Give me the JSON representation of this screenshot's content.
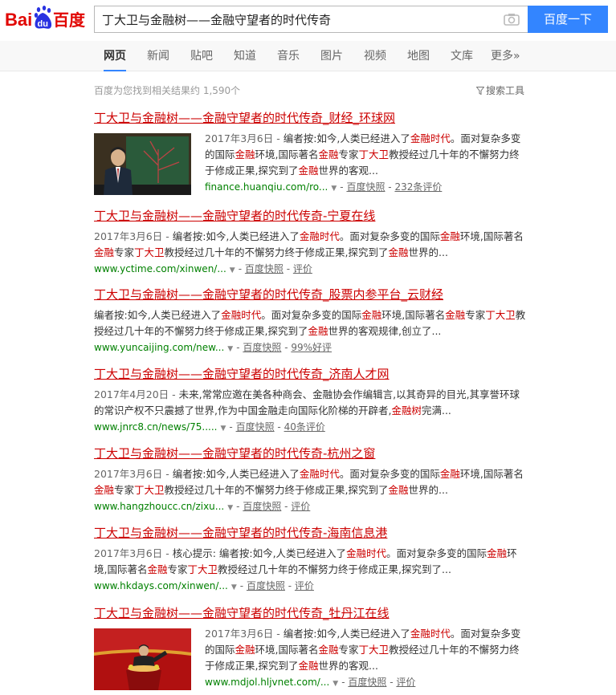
{
  "header": {
    "logo_text_red": "Bai",
    "logo_text_blue": "du",
    "logo_text_cn": "百度",
    "query": "丁大卫与金融树——金融守望者的时代传奇",
    "search_button": "百度一下",
    "brand_red": "#e10602",
    "brand_blue": "#2932e1"
  },
  "tabs": [
    {
      "label": "网页",
      "active": true
    },
    {
      "label": "新闻"
    },
    {
      "label": "贴吧"
    },
    {
      "label": "知道"
    },
    {
      "label": "音乐"
    },
    {
      "label": "图片"
    },
    {
      "label": "视频"
    },
    {
      "label": "地图"
    },
    {
      "label": "文库"
    },
    {
      "label": "更多»"
    }
  ],
  "meta": {
    "result_count": "百度为您找到相关结果约 1,590个",
    "search_tools": "搜索工具"
  },
  "results": [
    {
      "title": "丁大卫与金融树——金融守望者的时代传奇_财经_环球网",
      "abstract_html": "<span class=\"date\">2017年3月6日 - </span>编者按:如今,人类已经进入了<em>金融时代</em>。面对复杂多变的国际<em>金融</em>环境,国际著名<em>金融</em>专家<em>丁大卫</em>教授经过几十年的不懈努力终于修成正果,探究到了<em>金融</em>世界的客观...",
      "url": "finance.huanqiu.com/ro...",
      "snapshot": "百度快照",
      "extra": "232条评价",
      "thumb": "lecture"
    },
    {
      "title": "丁大卫与金融树——金融守望者的时代传奇-宁夏在线",
      "abstract_html": "<span class=\"date\">2017年3月6日 - </span>编者按:如今,人类已经进入了<em>金融时代</em>。面对复杂多变的国际<em>金融</em>环境,国际著名<em>金融</em>专家<em>丁大卫</em>教授经过几十年的不懈努力终于修成正果,探究到了<em>金融</em>世界的...",
      "url": "www.yctime.com/xinwen/...",
      "snapshot": "百度快照",
      "extra": "评价"
    },
    {
      "title": "丁大卫与金融树——金融守望者的时代传奇_股票内参平台_云财经",
      "abstract_html": "编者按:如今,人类已经进入了<em>金融时代</em>。面对复杂多变的国际<em>金融</em>环境,国际著名<em>金融</em>专家<em>丁大卫</em>教授经过几十年的不懈努力终于修成正果,探究到了<em>金融</em>世界的客观规律,创立了...",
      "url": "www.yuncaijing.com/new...",
      "snapshot": "百度快照",
      "extra": "99%好评"
    },
    {
      "title": "丁大卫与金融树——金融守望者的时代传奇_济南人才网",
      "abstract_html": "<span class=\"date\">2017年4月20日 - </span>未来,常常应邀在美各种商会、金融协会作编辑言,以其奇异的目光,其享誉环球的常识产权不只震撼了世界,作为中国金融走向国际化阶梯的开辟者,<em>金融树</em>完满...",
      "url": "www.jnrc8.cn/news/75.....",
      "snapshot": "百度快照",
      "extra": "40条评价"
    },
    {
      "title": "丁大卫与金融树——金融守望者的时代传奇-杭州之窗",
      "abstract_html": "<span class=\"date\">2017年3月6日 - </span>编者按:如今,人类已经进入了<em>金融时代</em>。面对复杂多变的国际<em>金融</em>环境,国际著名<em>金融</em>专家<em>丁大卫</em>教授经过几十年的不懈努力终于修成正果,探究到了<em>金融</em>世界的...",
      "url": "www.hangzhoucc.cn/zixu...",
      "snapshot": "百度快照",
      "extra": "评价"
    },
    {
      "title": "丁大卫与金融树——金融守望者的时代传奇-海南信息港",
      "abstract_html": "<span class=\"date\">2017年3月6日 - </span>核心提示: 编者按:如今,人类已经进入了<em>金融时代</em>。面对复杂多变的国际<em>金融</em>环境,国际著名<em>金融</em>专家<em>丁大卫</em>教授经过几十年的不懈努力终于修成正果,探究到了...",
      "url": "www.hkdays.com/xinwen/...",
      "snapshot": "百度快照",
      "extra": "评价"
    },
    {
      "title": "丁大卫与金融树——金融守望者的时代传奇_牡丹江在线",
      "abstract_html": "<span class=\"date\">2017年3月6日 - </span>编者按:如今,人类已经进入了<em>金融时代</em>。面对复杂多变的国际<em>金融</em>环境,国际著名<em>金融</em>专家<em>丁大卫</em>教授经过几十年的不懈努力终于修成正果,探究到了<em>金融</em>世界的客观...",
      "url": "www.mdjol.hljvnet.com/...",
      "snapshot": "百度快照",
      "extra": "评价",
      "thumb": "podium"
    }
  ]
}
